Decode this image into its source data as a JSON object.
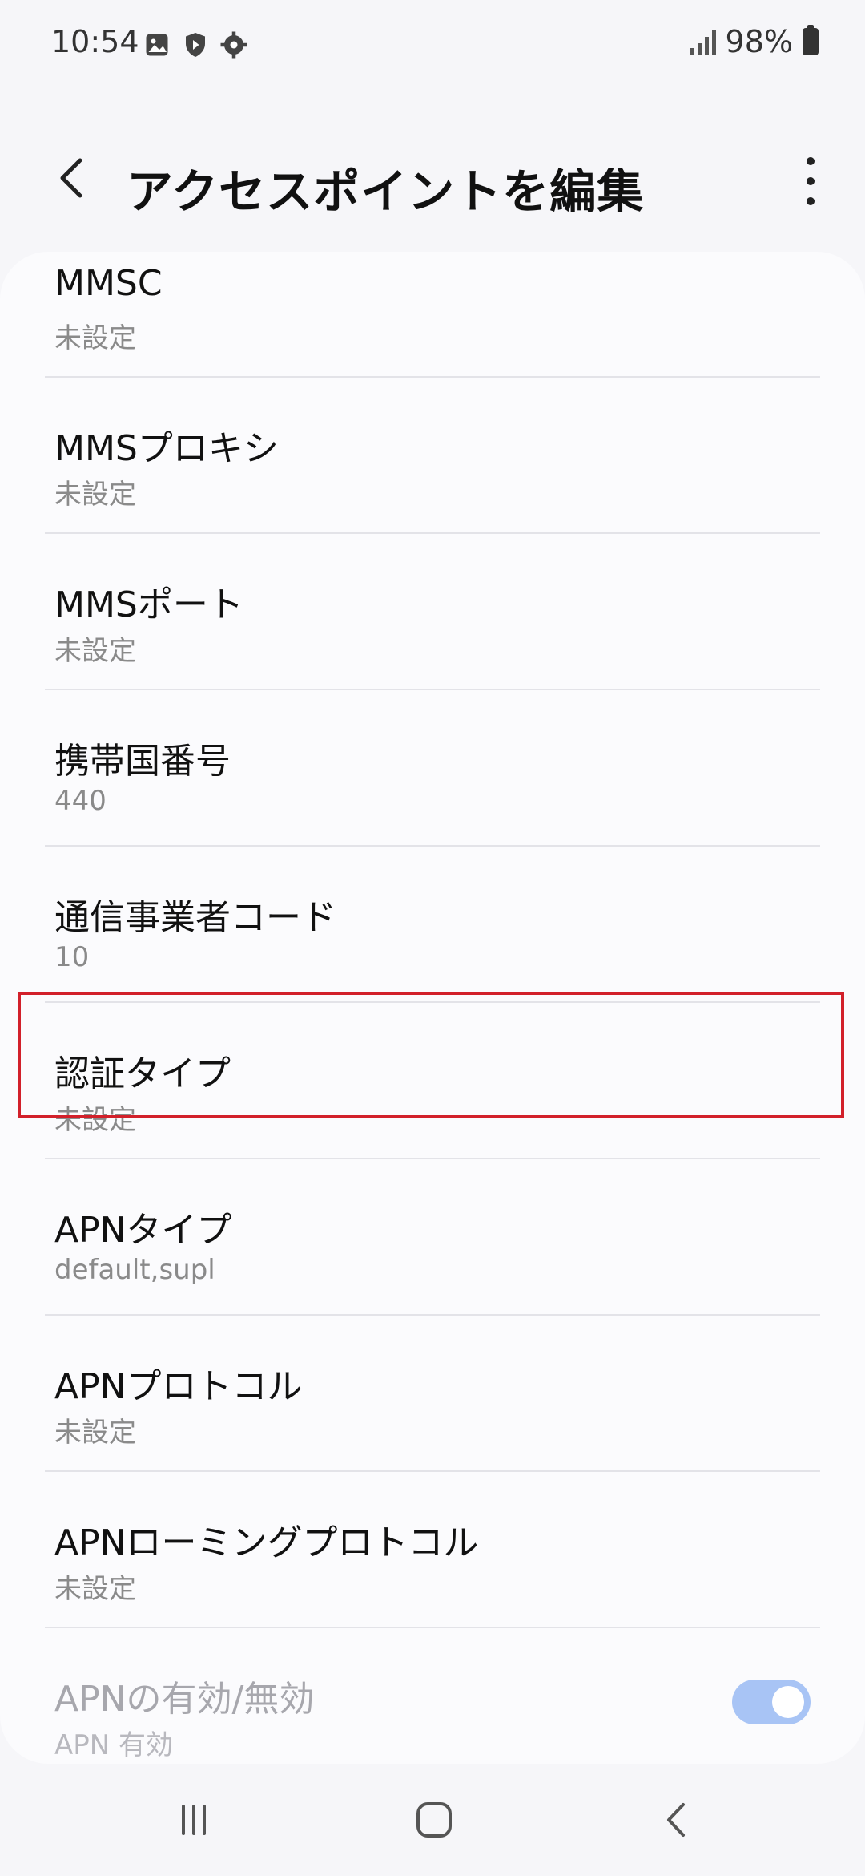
{
  "status_bar": {
    "time": "10:54",
    "battery": "98%"
  },
  "app_bar": {
    "title": "アクセスポイントを編集"
  },
  "items": [
    {
      "title": "MMSC",
      "value": "未設定"
    },
    {
      "title": "MMSプロキシ",
      "value": "未設定"
    },
    {
      "title": "MMSポート",
      "value": "未設定"
    },
    {
      "title": "携帯国番号",
      "value": "440"
    },
    {
      "title": "通信事業者コード",
      "value": "10"
    },
    {
      "title": "認証タイプ",
      "value": "未設定"
    },
    {
      "title": "APNタイプ",
      "value": "default,supl"
    },
    {
      "title": "APNプロトコル",
      "value": "未設定"
    },
    {
      "title": "APNローミングプロトコル",
      "value": "未設定"
    },
    {
      "title": "APNの有効/無効",
      "value": "APN 有効"
    }
  ],
  "colors": {
    "highlight": "#d2202a",
    "toggle_on": "#a8c4f5"
  }
}
